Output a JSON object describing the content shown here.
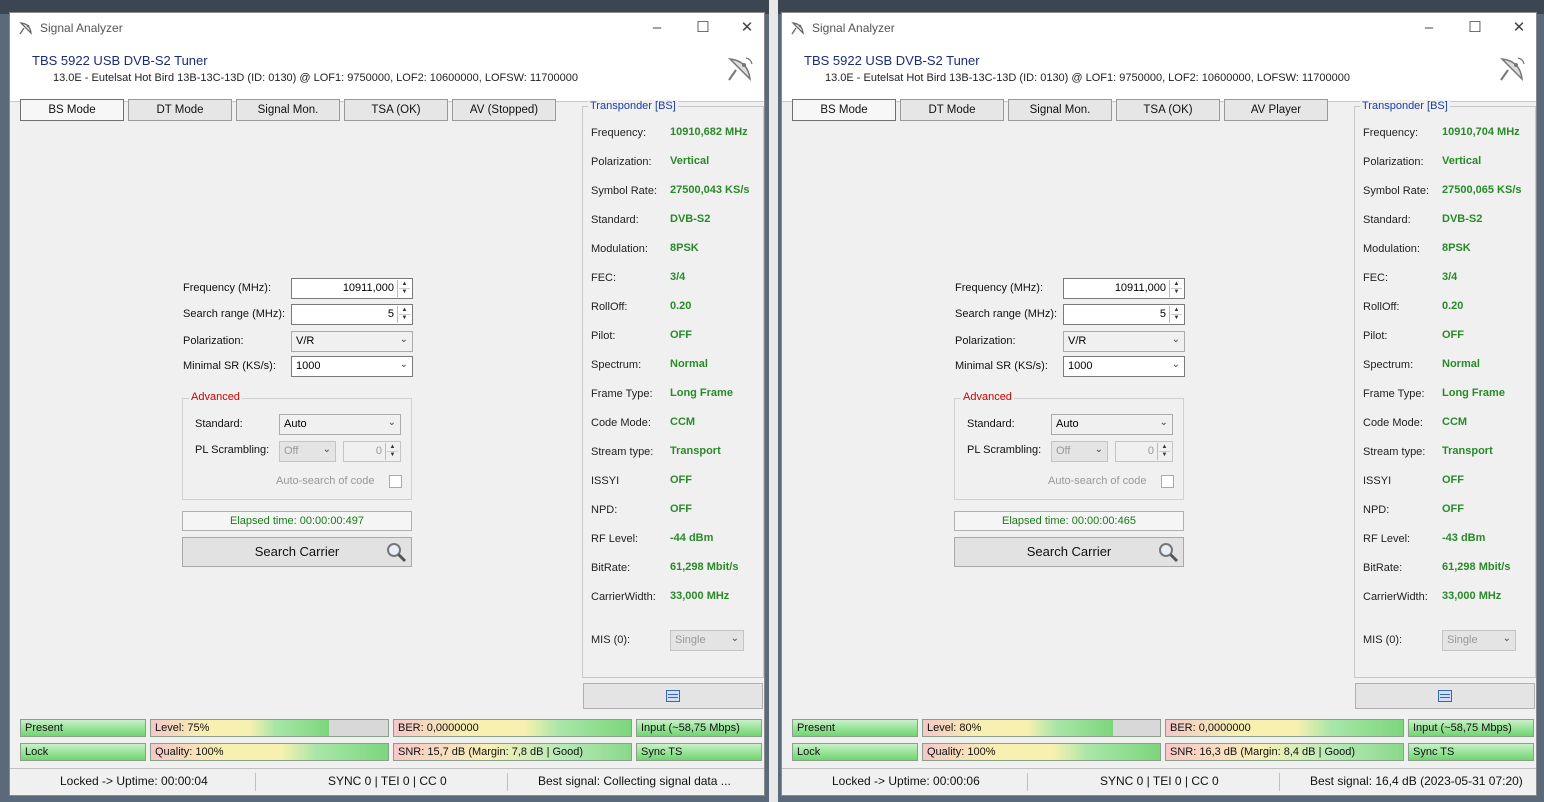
{
  "windows": [
    {
      "title": "Signal Analyzer",
      "tuner": "TBS 5922 USB DVB-S2 Tuner",
      "satellite": "13.0E - Eutelsat Hot Bird 13B-13C-13D (ID: 0130) @ LOF1: 9750000, LOF2: 10600000, LOFSW: 11700000",
      "tabs": [
        "BS Mode",
        "DT Mode",
        "Signal Mon.",
        "TSA (OK)",
        "AV (Stopped)"
      ],
      "form": {
        "frequency_label": "Frequency (MHz):",
        "frequency": "10911,000",
        "search_range_label": "Search range (MHz):",
        "search_range": "5",
        "polarization_label": "Polarization:",
        "polarization": "V/R",
        "minsr_label": "Minimal SR (KS/s):",
        "minsr": "1000",
        "advanced_label": "Advanced",
        "standard_label": "Standard:",
        "standard": "Auto",
        "pls_label": "PL Scrambling:",
        "pls": "Off",
        "pls_code": "0",
        "autosearch_label": "Auto-search of code",
        "elapsed": "Elapsed time: 00:00:00:497",
        "search_button": "Search Carrier"
      },
      "transponder": {
        "title": "Transponder [BS]",
        "rows": [
          {
            "label": "Frequency:",
            "value": "10910,682 MHz"
          },
          {
            "label": "Polarization:",
            "value": "Vertical"
          },
          {
            "label": "Symbol Rate:",
            "value": "27500,043 KS/s"
          },
          {
            "label": "Standard:",
            "value": "DVB-S2"
          },
          {
            "label": "Modulation:",
            "value": "8PSK"
          },
          {
            "label": "FEC:",
            "value": "3/4"
          },
          {
            "label": "RollOff:",
            "value": "0.20"
          },
          {
            "label": "Pilot:",
            "value": "OFF"
          },
          {
            "label": "Spectrum:",
            "value": "Normal"
          },
          {
            "label": "Frame Type:",
            "value": "Long Frame"
          },
          {
            "label": "Code Mode:",
            "value": "CCM"
          },
          {
            "label": "Stream type:",
            "value": "Transport"
          },
          {
            "label": "ISSYI",
            "value": "OFF"
          },
          {
            "label": "NPD:",
            "value": "OFF"
          },
          {
            "label": "RF Level:",
            "value": "-44 dBm"
          },
          {
            "label": "BitRate:",
            "value": "61,298 Mbit/s"
          },
          {
            "label": "CarrierWidth:",
            "value": "33,000 MHz"
          }
        ],
        "mis_label": "MIS (0):",
        "mis_value": "Single"
      },
      "indicators": {
        "present": "Present",
        "level": "Level: 75%",
        "ber": "BER: 0,0000000",
        "input": "Input (~58,75 Mbps)",
        "lock": "Lock",
        "quality": "Quality: 100%",
        "snr": "SNR: 15,7 dB (Margin: 7,8 dB | Good)",
        "sync": "Sync TS",
        "level_pct": 75,
        "quality_pct": 100,
        "ber_pct": 100,
        "snr_pct": 100
      },
      "status": {
        "left": "Locked -> Uptime: 00:00:04",
        "mid": "SYNC 0 | TEI 0 | CC 0",
        "right": "Best signal: Collecting signal data ..."
      }
    },
    {
      "title": "Signal Analyzer",
      "tuner": "TBS 5922 USB DVB-S2 Tuner",
      "satellite": "13.0E - Eutelsat Hot Bird 13B-13C-13D (ID: 0130) @ LOF1: 9750000, LOF2: 10600000, LOFSW: 11700000",
      "tabs": [
        "BS Mode",
        "DT Mode",
        "Signal Mon.",
        "TSA (OK)",
        "AV Player"
      ],
      "form": {
        "frequency_label": "Frequency (MHz):",
        "frequency": "10911,000",
        "search_range_label": "Search range (MHz):",
        "search_range": "5",
        "polarization_label": "Polarization:",
        "polarization": "V/R",
        "minsr_label": "Minimal SR (KS/s):",
        "minsr": "1000",
        "advanced_label": "Advanced",
        "standard_label": "Standard:",
        "standard": "Auto",
        "pls_label": "PL Scrambling:",
        "pls": "Off",
        "pls_code": "0",
        "autosearch_label": "Auto-search of code",
        "elapsed": "Elapsed time: 00:00:00:465",
        "search_button": "Search Carrier"
      },
      "transponder": {
        "title": "Transponder [BS]",
        "rows": [
          {
            "label": "Frequency:",
            "value": "10910,704 MHz"
          },
          {
            "label": "Polarization:",
            "value": "Vertical"
          },
          {
            "label": "Symbol Rate:",
            "value": "27500,065 KS/s"
          },
          {
            "label": "Standard:",
            "value": "DVB-S2"
          },
          {
            "label": "Modulation:",
            "value": "8PSK"
          },
          {
            "label": "FEC:",
            "value": "3/4"
          },
          {
            "label": "RollOff:",
            "value": "0.20"
          },
          {
            "label": "Pilot:",
            "value": "OFF"
          },
          {
            "label": "Spectrum:",
            "value": "Normal"
          },
          {
            "label": "Frame Type:",
            "value": "Long Frame"
          },
          {
            "label": "Code Mode:",
            "value": "CCM"
          },
          {
            "label": "Stream type:",
            "value": "Transport"
          },
          {
            "label": "ISSYI",
            "value": "OFF"
          },
          {
            "label": "NPD:",
            "value": "OFF"
          },
          {
            "label": "RF Level:",
            "value": "-43 dBm"
          },
          {
            "label": "BitRate:",
            "value": "61,298 Mbit/s"
          },
          {
            "label": "CarrierWidth:",
            "value": "33,000 MHz"
          }
        ],
        "mis_label": "MIS (0):",
        "mis_value": "Single"
      },
      "indicators": {
        "present": "Present",
        "level": "Level: 80%",
        "ber": "BER: 0,0000000",
        "input": "Input (~58,75 Mbps)",
        "lock": "Lock",
        "quality": "Quality: 100%",
        "snr": "SNR: 16,3 dB (Margin: 8,4 dB | Good)",
        "sync": "Sync TS",
        "level_pct": 80,
        "quality_pct": 100,
        "ber_pct": 100,
        "snr_pct": 100
      },
      "status": {
        "left": "Locked -> Uptime: 00:00:06",
        "mid": "SYNC 0 | TEI 0 | CC 0",
        "right": "Best signal: 16,4 dB (2023-05-31 07:20)"
      }
    }
  ],
  "icons": {
    "app": "satellite-dish-icon",
    "header": "satellite-dish-icon",
    "search": "magnifier-icon",
    "panel_button": "list-window-icon"
  },
  "colors": {
    "value_green": "#2a8a2a",
    "title_blue": "#1a2b7a",
    "advanced_red": "#cc0000",
    "indicator_green": "#6ed66e"
  }
}
